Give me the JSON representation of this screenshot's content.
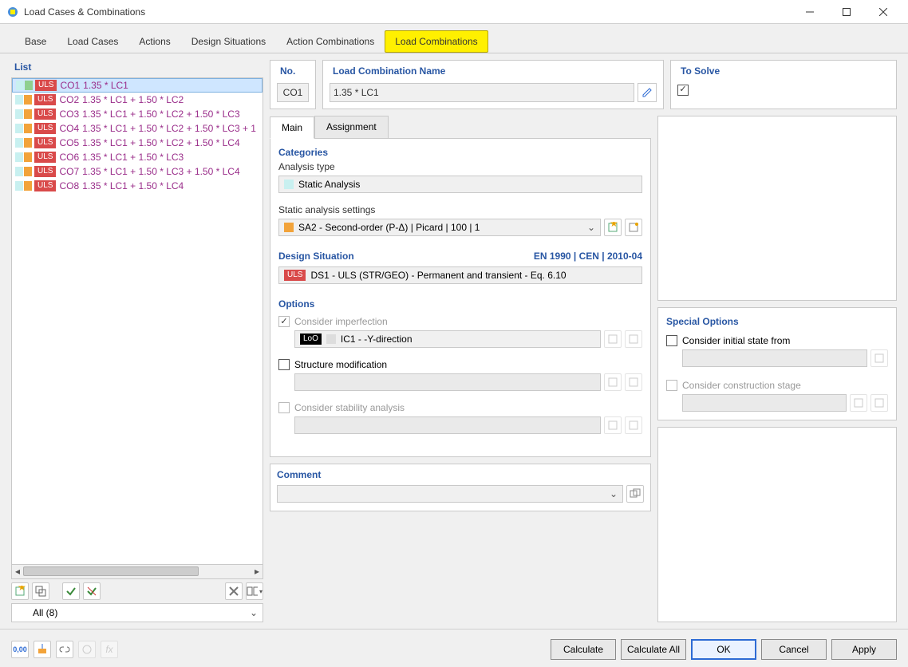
{
  "window": {
    "title": "Load Cases & Combinations"
  },
  "tabs": [
    "Base",
    "Load Cases",
    "Actions",
    "Design Situations",
    "Action Combinations",
    "Load Combinations"
  ],
  "active_tab": 5,
  "list": {
    "title": "List",
    "items": [
      {
        "badge": "ULS",
        "id": "CO1",
        "desc": "1.35 * LC1",
        "sel": true,
        "sw": [
          "#8fd08f",
          "#cc5b5b"
        ]
      },
      {
        "badge": "ULS",
        "id": "CO2",
        "desc": "1.35 * LC1 + 1.50 * LC2",
        "sel": false,
        "sw": [
          "#f2a33a",
          "#cc5b5b"
        ]
      },
      {
        "badge": "ULS",
        "id": "CO3",
        "desc": "1.35 * LC1 + 1.50 * LC2 + 1.50 * LC3",
        "sel": false,
        "sw": [
          "#f2a33a",
          "#cc5b5b"
        ]
      },
      {
        "badge": "ULS",
        "id": "CO4",
        "desc": "1.35 * LC1 + 1.50 * LC2 + 1.50 * LC3 + 1",
        "sel": false,
        "sw": [
          "#f2a33a",
          "#cc5b5b"
        ]
      },
      {
        "badge": "ULS",
        "id": "CO5",
        "desc": "1.35 * LC1 + 1.50 * LC2 + 1.50 * LC4",
        "sel": false,
        "sw": [
          "#f2a33a",
          "#cc5b5b"
        ]
      },
      {
        "badge": "ULS",
        "id": "CO6",
        "desc": "1.35 * LC1 + 1.50 * LC3",
        "sel": false,
        "sw": [
          "#f2a33a",
          "#cc5b5b"
        ]
      },
      {
        "badge": "ULS",
        "id": "CO7",
        "desc": "1.35 * LC1 + 1.50 * LC3 + 1.50 * LC4",
        "sel": false,
        "sw": [
          "#f2a33a",
          "#cc5b5b"
        ]
      },
      {
        "badge": "ULS",
        "id": "CO8",
        "desc": "1.35 * LC1 + 1.50 * LC4",
        "sel": false,
        "sw": [
          "#f2a33a",
          "#cc5b5b"
        ]
      }
    ],
    "filter": "All (8)"
  },
  "header": {
    "no_label": "No.",
    "no_value": "CO1",
    "name_label": "Load Combination Name",
    "name_value": "1.35 * LC1",
    "solve_label": "To Solve",
    "solve_checked": true
  },
  "subtabs": [
    "Main",
    "Assignment"
  ],
  "active_subtab": 0,
  "categories": {
    "head": "Categories",
    "analysis_type_label": "Analysis type",
    "analysis_type_value": "Static Analysis",
    "sas_label": "Static analysis settings",
    "sas_value": "SA2 - Second-order (P-Δ) | Picard | 100 | 1"
  },
  "design_situation": {
    "head": "Design Situation",
    "right": "EN 1990 | CEN | 2010-04",
    "badge": "ULS",
    "value": "DS1 - ULS (STR/GEO) - Permanent and transient - Eq. 6.10"
  },
  "options": {
    "head": "Options",
    "imperfection_label": "Consider imperfection",
    "imperfection_badge": "LoO",
    "imperfection_value": "IC1 - -Y-direction",
    "struct_mod_label": "Structure modification",
    "stability_label": "Consider stability analysis"
  },
  "special": {
    "head": "Special Options",
    "initial_state_label": "Consider initial state from",
    "construction_stage_label": "Consider construction stage"
  },
  "comment": {
    "head": "Comment"
  },
  "footer": {
    "calculate": "Calculate",
    "calculate_all": "Calculate All",
    "ok": "OK",
    "cancel": "Cancel",
    "apply": "Apply"
  }
}
